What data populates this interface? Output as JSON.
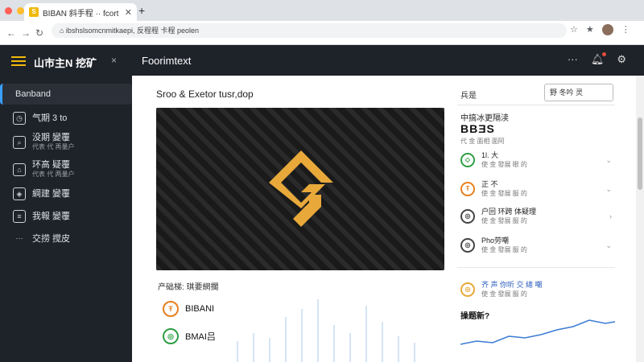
{
  "browser": {
    "tab_title": "BIBAN 斜手程 ·· fcort",
    "tab_favicon": "S",
    "address": "⌂ ibshslsomcnmitkaepi, 反程程 卡程 peolen",
    "new_tab_icon": "+"
  },
  "app": {
    "name": "山市主N 挖矿",
    "close": "×",
    "header_title": "Foorimtext",
    "menu_icon": "···"
  },
  "sidebar": {
    "items": [
      {
        "label": "Banband",
        "sub": ""
      },
      {
        "label": "气期 3 to",
        "sub": ""
      },
      {
        "label": "没期 變覆",
        "sub": "代表 代 再量户"
      },
      {
        "label": "环高 疑覆",
        "sub": "代表 代 两量户"
      },
      {
        "label": "綱建 變覆",
        "sub": ""
      },
      {
        "label": "我報 變覆",
        "sub": ""
      },
      {
        "label": "交捞 搅皮",
        "sub": ""
      }
    ]
  },
  "main": {
    "title": "Sroo & Exetor tusr,dop",
    "section_label": "产础梯:  琪要網擱",
    "coins": [
      {
        "symbol": "Ŧ",
        "name": "BIBANI",
        "color": "#e8801e"
      },
      {
        "symbol": "◎",
        "name": "BMAI吕",
        "color": "#2f9e44"
      }
    ]
  },
  "right": {
    "header": "兵是",
    "search_value": "野 冬吟 灵",
    "panel_title": "中搞冰更隔渎",
    "panel_big": "BBƎS",
    "panel_sub": "代 金 面相 面阿",
    "rows": [
      {
        "title": "1l. 大",
        "sub": "使 金 發展 眼 的",
        "color": "#2f9e44"
      },
      {
        "title": "正 不",
        "sub": "使 金 發展 服 的",
        "color": "#e8801e"
      },
      {
        "title": "户回 环跨 体疑理",
        "sub": "使 金 發展 服 的",
        "color": "#444"
      },
      {
        "title": "Pho劳嘲",
        "sub": "使 金 發展 服 的",
        "color": "#444"
      }
    ],
    "news_title": "齐 声 你听 交 總 嘲",
    "news_sub": "使 金 發展 服 的",
    "question": "操题新?"
  },
  "colors": {
    "accent": "#f0b90b",
    "dark_bg": "#1e2229",
    "active_indicator": "#3aa0ff",
    "link": "#2d5fbf"
  }
}
